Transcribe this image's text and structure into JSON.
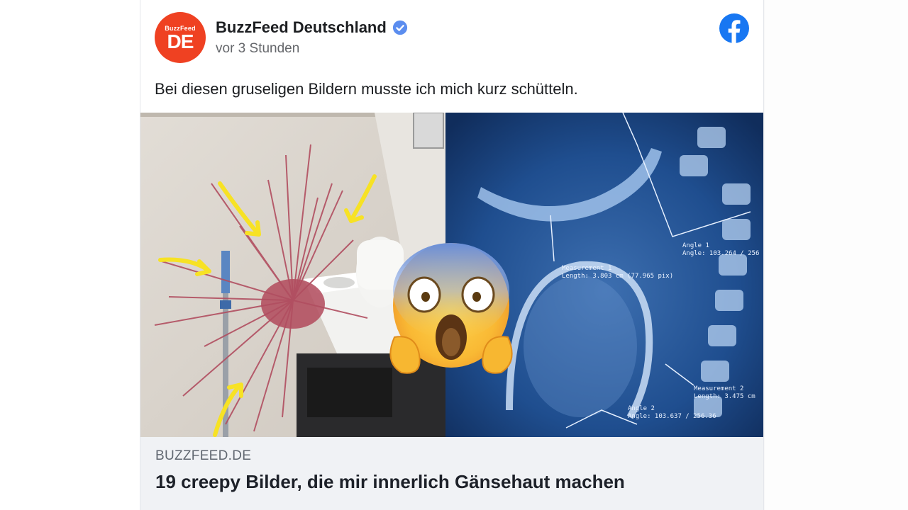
{
  "post": {
    "page_name": "BuzzFeed Deutschland",
    "timestamp": "vor 3 Stunden",
    "text": "Bei diesen gruseligen Bildern musste ich mich kurz schütteln.",
    "avatar": {
      "small_text": "BuzzFeed",
      "big_text": "DE",
      "color": "#ef4122"
    },
    "verified": true
  },
  "link_preview": {
    "domain": "BUZZFEED.DE",
    "title": "19 creepy Bilder, die mir innerlich Gänsehaut machen"
  },
  "image": {
    "left_panel_annotations": [],
    "right_panel_labels": {
      "measurement_1": "Measurement 1",
      "length_1": "Length: 3.803 cm (77.965 pix)",
      "angle_1_title": "Angle 1",
      "angle_1_value": "Angle: 103.264 / 256",
      "measurement_2": "Measurement 2",
      "length_2": "Length: 3.475 cm",
      "angle_2_title": "Angle 2",
      "angle_2_value": "Angle: 103.637 / 256.36"
    },
    "emoji": "screaming-face"
  },
  "colors": {
    "facebook_blue": "#1877f2",
    "verified_blue": "#5b8def",
    "xray_blue": "#1f4e8f"
  }
}
